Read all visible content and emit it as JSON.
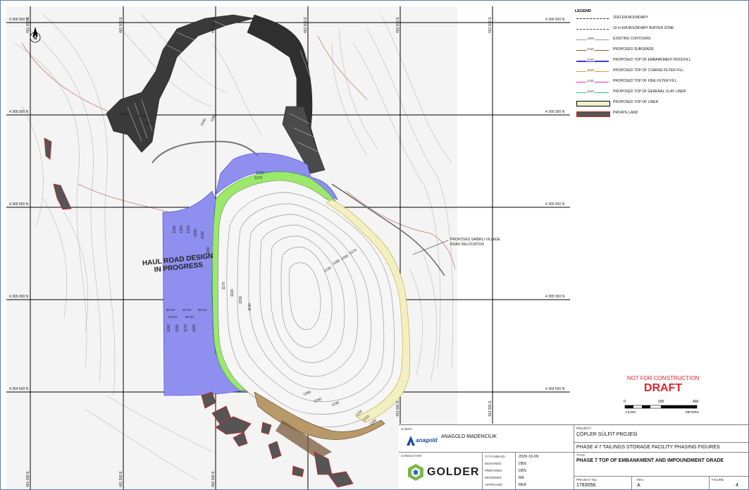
{
  "map": {
    "northing_labels": [
      "4 366 500  N",
      "4 366 000  N",
      "4 365 500  N",
      "4 365 000  N",
      "4 364 500  N"
    ],
    "easting_labels": [
      "461 000  E",
      "461 500  E",
      "462 000  E",
      "462 500  E",
      "463 000  E",
      "463 500  E"
    ],
    "annotations": {
      "haul_road_line1": "HAUL ROAD DESIGN",
      "haul_road_line2": "IN PROGRESS",
      "road_relocation_line1": "PROPOSED SABIRLI VILLAGE",
      "road_relocation_line2": "ROAD RELOCATION"
    },
    "contour_labels": [
      "1260",
      "1270",
      "1280",
      "1240",
      "1230",
      "1220",
      "1210",
      "1200",
      "1190",
      "1180",
      "1170",
      "1160",
      "1150",
      "1140",
      "1130",
      "1290"
    ],
    "slope_labels": [
      "2H:1V",
      "5H:1V"
    ]
  },
  "legend": {
    "title": "LEGEND",
    "items": [
      {
        "label": "2020 EIA BOUNDARY",
        "num": "",
        "color": "#222222"
      },
      {
        "label": "10 m EIA BOUNDARY BUFFER ZONE",
        "num": "",
        "color": "#444444"
      },
      {
        "label": "EXISTING CONTOURS",
        "num": "1000",
        "color": "#9a9a9a"
      },
      {
        "label": "PROPOSED SUBGRADE",
        "num": "1210",
        "color": "#8b5a2b"
      },
      {
        "label": "PROPOSED TOP OF EMBANKMENT ROCKFILL",
        "num": "1140",
        "color": "#3a3adf"
      },
      {
        "label": "PROPOSED TOP OF COARSE FILTER FILL",
        "num": "1210",
        "color": "#e0a020"
      },
      {
        "label": "PROPOSED TOP OF FINE FILTER FILL",
        "num": "1210",
        "color": "#e02bd0"
      },
      {
        "label": "PROPOSED TOP OF GENERAL CLAY LINER",
        "num": "1210",
        "color": "#20c890"
      },
      {
        "label": "PROPOSED TOP OF LINER",
        "num": "",
        "color": "#eef3c8"
      },
      {
        "label": "PRIVATE LAND",
        "num": "",
        "color": "#555555"
      }
    ]
  },
  "stamp": {
    "not_for_construction": "NOT FOR CONSTRUCTION",
    "draft": "DRAFT"
  },
  "scale": {
    "ticks": [
      "0",
      "200",
      "400"
    ],
    "ratio": "1:5,000",
    "unit": "METERS"
  },
  "titleblock": {
    "client_label": "CLIENT",
    "client_name": "ANAGOLD MADENCİLİK",
    "client_logo_text": "anagold",
    "consultant_label": "CONSULTANT",
    "consultant_logo_text": "GOLDER",
    "date_label": "YYYY-MM-DD",
    "date_value": "2020-10-09",
    "designed_label": "DESIGNED",
    "designed_value": "DBS",
    "prepared_label": "PREPARED",
    "prepared_value": "DBS",
    "reviewed_label": "REVIEWED",
    "reviewed_value": "MK",
    "approved_label": "APPROVED",
    "approved_value": "REK",
    "project_label": "PROJECT",
    "project_name": "ÇÖPLER SÜLFİT PROJESİ",
    "project_sub": "PHASE 4-7 TAILINGS STORAGE FACILITY PHASING FIGURES",
    "title_label": "TITLE",
    "title_value": "PHASE 7 TOP OF EMBANKMENT AND IMPOUNDMENT GRADE",
    "project_no_label": "PROJECT NO.",
    "project_no_value": "1783056",
    "rev_label": "REV.",
    "rev_value": "A",
    "figure_label": "FIGURE",
    "figure_value": "4"
  }
}
